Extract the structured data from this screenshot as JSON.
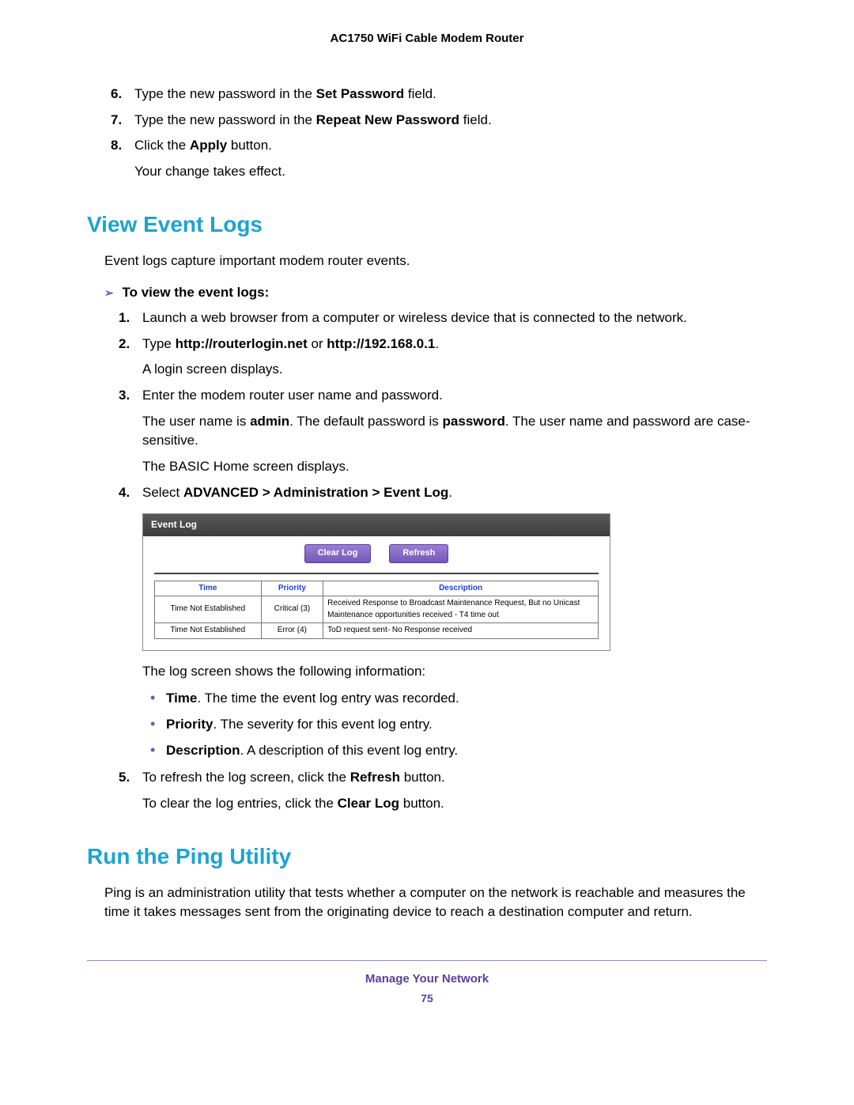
{
  "doc_header": "AC1750 WiFi Cable Modem Router",
  "top_steps": [
    {
      "n": "6.",
      "pre": "Type the new password in the ",
      "bold": "Set Password",
      "post": " field."
    },
    {
      "n": "7.",
      "pre": "Type the new password in the ",
      "bold": "Repeat New Password",
      "post": " field."
    },
    {
      "n": "8.",
      "pre": "Click the ",
      "bold": "Apply",
      "post": " button."
    }
  ],
  "top_after": "Your change takes effect.",
  "section1": "View Event Logs",
  "section1_intro": "Event logs capture important modem router events.",
  "task1_head": "To view the event logs:",
  "steps1": {
    "s1": {
      "n": "1.",
      "text": "Launch a web browser from a computer or wireless device that is connected to the network."
    },
    "s2": {
      "n": "2.",
      "pre": "Type ",
      "b1": "http://routerlogin.net",
      "mid": " or ",
      "b2": "http://192.168.0.1",
      "post": ".",
      "follow": "A login screen displays."
    },
    "s3": {
      "n": "3.",
      "text": "Enter the modem router user name and password.",
      "f1_pre": "The user name is ",
      "f1_b1": "admin",
      "f1_mid": ". The default password is ",
      "f1_b2": "password",
      "f1_post": ". The user name and password are case-sensitive.",
      "f2": "The BASIC Home screen displays."
    },
    "s4": {
      "n": "4.",
      "pre": "Select ",
      "bold": "ADVANCED > Administration > Event Log",
      "post": "."
    }
  },
  "screenshot": {
    "title": "Event Log",
    "btn1": "Clear Log",
    "btn2": "Refresh",
    "th1": "Time",
    "th2": "Priority",
    "th3": "Description",
    "rows": [
      {
        "time": "Time Not Established",
        "pri": "Critical (3)",
        "desc": "Received Response to Broadcast Maintenance Request, But no Unicast Maintenance opportunities received - T4 time out"
      },
      {
        "time": "Time Not Established",
        "pri": "Error (4)",
        "desc": "ToD request sent- No Response received"
      }
    ]
  },
  "after_screenshot": "The log screen shows the following information:",
  "bullets": [
    {
      "bold": "Time",
      "text": ". The time the event log entry was recorded."
    },
    {
      "bold": "Priority",
      "text": ". The severity for this event log entry."
    },
    {
      "bold": "Description",
      "text": ". A description of this event log entry."
    }
  ],
  "steps1_s5": {
    "n": "5.",
    "pre": "To refresh the log screen, click the ",
    "bold": "Refresh",
    "post": " button."
  },
  "clear_line": {
    "pre": "To clear the log entries, click the ",
    "bold": "Clear Log",
    "post": " button."
  },
  "section2": "Run the Ping Utility",
  "section2_body": "Ping is an administration utility that tests whether a computer on the network is reachable and measures the time it takes messages sent from the originating device to reach a destination computer and return.",
  "footer_title": "Manage Your Network",
  "footer_page": "75"
}
